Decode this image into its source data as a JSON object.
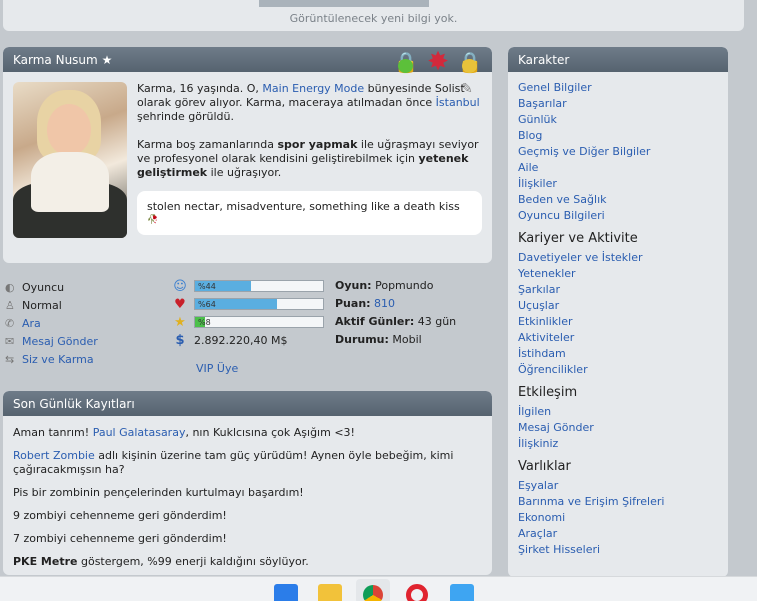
{
  "top": {
    "message": "Görüntülenecek yeni bilgi yok."
  },
  "profile": {
    "title": "Karma Nusum",
    "title_star": "★",
    "badges": [
      "lock-green-icon",
      "red-star-icon",
      "lock-yellow-icon"
    ],
    "bio": {
      "p1_a": "Karma, 16 yaşında. O, ",
      "p1_link1": "Main Energy Mode",
      "p1_b": " bünyesinde Solist olarak görev alıyor. Karma, maceraya atılmadan önce ",
      "p1_link2": "İstanbul",
      "p1_c": " şehrinde görüldü.",
      "p2_a": "Karma boş zamanlarında ",
      "p2_bold1": "spor yapmak",
      "p2_b": " ile uğraşmayı seviyor ve profesyonel olarak kendisini geliştirebilmek için ",
      "p2_bold2": "yetenek geliştirmek",
      "p2_c": " ile uğraşıyor."
    },
    "quote": "stolen nectar, misadventure, something like a death kiss",
    "quote_emoji": "🥀"
  },
  "stats": {
    "left": [
      {
        "icon": "globe-icon",
        "label": "Oyuncu",
        "link": false
      },
      {
        "icon": "person-icon",
        "label": "Normal",
        "link": false
      },
      {
        "icon": "phone-icon",
        "label": "Ara",
        "link": true
      },
      {
        "icon": "envelope-icon",
        "label": "Mesaj Gönder",
        "link": true
      },
      {
        "icon": "swap-icon",
        "label": "Siz ve Karma",
        "link": true
      }
    ],
    "bars": [
      {
        "icon": "smiley-icon",
        "label": "%44",
        "value": 0.44,
        "color": "#5aaee0"
      },
      {
        "icon": "heart-icon",
        "label": "%64",
        "value": 0.64,
        "color": "#5aaee0"
      },
      {
        "icon": "star-icon",
        "label": "%8",
        "value": 0.08,
        "color": "#4cc04a"
      }
    ],
    "money_icon": "dollar-icon",
    "money": "2.892.220,40 M$",
    "vip": "VIP Üye",
    "info": {
      "game_label": "Oyun:",
      "game_value": "Popmundo",
      "points_label": "Puan:",
      "points_value": "810",
      "active_label": "Aktif Günler:",
      "active_value": "43 gün",
      "status_label": "Durumu:",
      "status_value": "Mobil"
    }
  },
  "diary": {
    "title": "Son Günlük Kayıtları",
    "e1_a": "Aman tanrım! ",
    "e1_link": "Paul Galatasaray",
    "e1_b": ", nın Kuklcısına çok Aşığım <3!",
    "e2_link": "Robert Zombie",
    "e2_b": " adlı kişinin üzerine tam güç yürüdüm! Aynen öyle bebeğim, kimi çağıracakmışsın ha?",
    "e3": "Pis bir zombinin pençelerinden kurtulmayı başardım!",
    "e4": "9 zombiyi cehenneme geri gönderdim!",
    "e5": "7 zombiyi cehenneme geri gönderdim!",
    "e6_bold": "PKE Metre",
    "e6_b": " göstergem, %99 enerji kaldığını söylüyor."
  },
  "sidebar": {
    "title": "Karakter",
    "links1": [
      "Genel Bilgiler",
      "Başarılar",
      "Günlük",
      "Blog",
      "Geçmiş ve Diğer Bilgiler",
      "Aile",
      "İlişkiler",
      "Beden ve Sağlık",
      "Oyuncu Bilgileri"
    ],
    "section2": "Kariyer ve Aktivite",
    "links2": [
      "Davetiyeler ve İstekler",
      "Yetenekler",
      "Şarkılar",
      "Uçuşlar",
      "Etkinlikler",
      "Aktiviteler",
      "İstihdam",
      "Öğrencilikler"
    ],
    "section3": "Etkileşim",
    "links3": [
      "İlgilen",
      "Mesaj Gönder",
      "İlişkiniz"
    ],
    "section4": "Varlıklar",
    "links4": [
      "Eşyalar",
      "Barınma ve Erişim Şifreleri",
      "Ekonomi",
      "Araçlar",
      "Şirket Hisseleri"
    ]
  },
  "taskbar": [
    "windows-start-icon",
    "file-explorer-icon",
    "chrome-icon",
    "opera-icon",
    "app-icon"
  ]
}
